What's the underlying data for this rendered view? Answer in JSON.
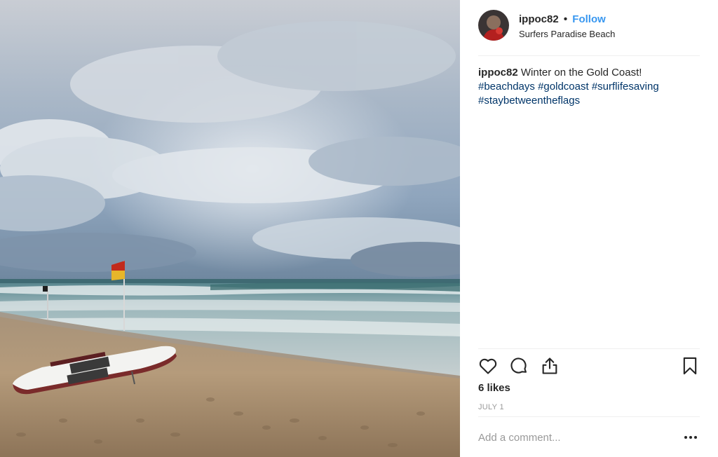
{
  "post": {
    "image_alt": "Beach scene with surf rescue board and flags",
    "author": {
      "username": "ippoc82",
      "follow_label": "Follow",
      "separator": "•",
      "location": "Surfers Paradise Beach",
      "avatar_icon": "profile-avatar"
    },
    "caption": {
      "username": "ippoc82",
      "text": "Winter on the Gold Coast!",
      "hashtags": [
        "#beachdays",
        "#goldcoast",
        "#surflifesaving",
        "#staybetweentheflags"
      ]
    },
    "actions": {
      "like_icon": "heart-icon",
      "comment_icon": "comment-bubble-icon",
      "share_icon": "share-upload-icon",
      "save_icon": "bookmark-icon"
    },
    "likes_text": "6 likes",
    "date_text": "JULY 1",
    "comment": {
      "placeholder": "Add a comment...",
      "value": "",
      "more_icon": "more-dots-icon"
    }
  },
  "colors": {
    "follow": "#3897f0",
    "hashtag": "#003569",
    "muted": "#999999",
    "divider": "#efefef"
  }
}
